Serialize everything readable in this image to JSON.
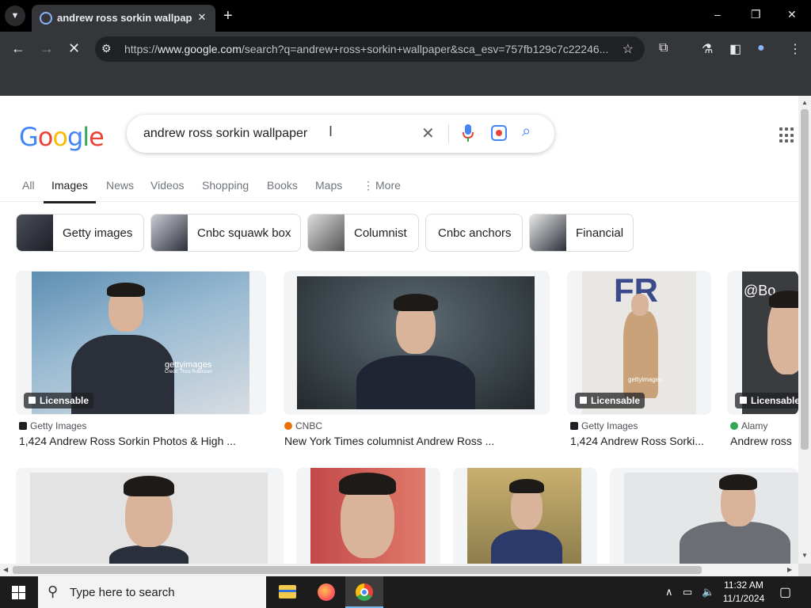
{
  "browser": {
    "tab_title": "andrew ross sorkin wallpaper",
    "tab_close": "✕",
    "new_tab": "+",
    "url_prefix": "https://",
    "url_host": "www.google.com",
    "url_path": "/search?q=andrew+ross+sorkin+wallpaper&sca_esv=757fb129c7c22246...",
    "window_controls": [
      "–",
      "❐",
      "✕"
    ]
  },
  "search": {
    "logo_letters": [
      "G",
      "o",
      "o",
      "g",
      "l",
      "e"
    ],
    "query": "andrew ross sorkin wallpaper",
    "clear_glyph": "✕",
    "mag_glyph": "⚲"
  },
  "tabs": [
    {
      "label": "All"
    },
    {
      "label": "Images"
    },
    {
      "label": "News"
    },
    {
      "label": "Videos"
    },
    {
      "label": "Shopping"
    },
    {
      "label": "Books"
    },
    {
      "label": "Maps"
    },
    {
      "label": "More"
    }
  ],
  "more_glyph": "⋮",
  "chips": [
    {
      "label": "Getty images"
    },
    {
      "label": "Cnbc squawk box"
    },
    {
      "label": "Columnist"
    },
    {
      "label": "Cnbc anchors"
    },
    {
      "label": "Financial"
    }
  ],
  "results": [
    {
      "source": "Getty Images",
      "title": "1,424 Andrew Ross Sorkin Photos & High ...",
      "badge": "Licensable",
      "overlay": "gettyimages",
      "credit": "Credit: Thos Robinson",
      "source_color": "#202124"
    },
    {
      "source": "CNBC",
      "title": "New York Times columnist Andrew Ross ...",
      "badge": "",
      "source_color": "#e8710a"
    },
    {
      "source": "Getty Images",
      "title": "1,424 Andrew Ross Sorki...",
      "badge": "Licensable",
      "overlay": "gettyimages",
      "source_color": "#202124"
    },
    {
      "source": "Alamy",
      "title": "Andrew ross",
      "badge": "Licensable",
      "overlay": "@Bo",
      "source_color": "#34a853"
    }
  ],
  "taskbar": {
    "search_placeholder": "Type here to search",
    "time": "11:32 AM",
    "date": "11/1/2024"
  }
}
